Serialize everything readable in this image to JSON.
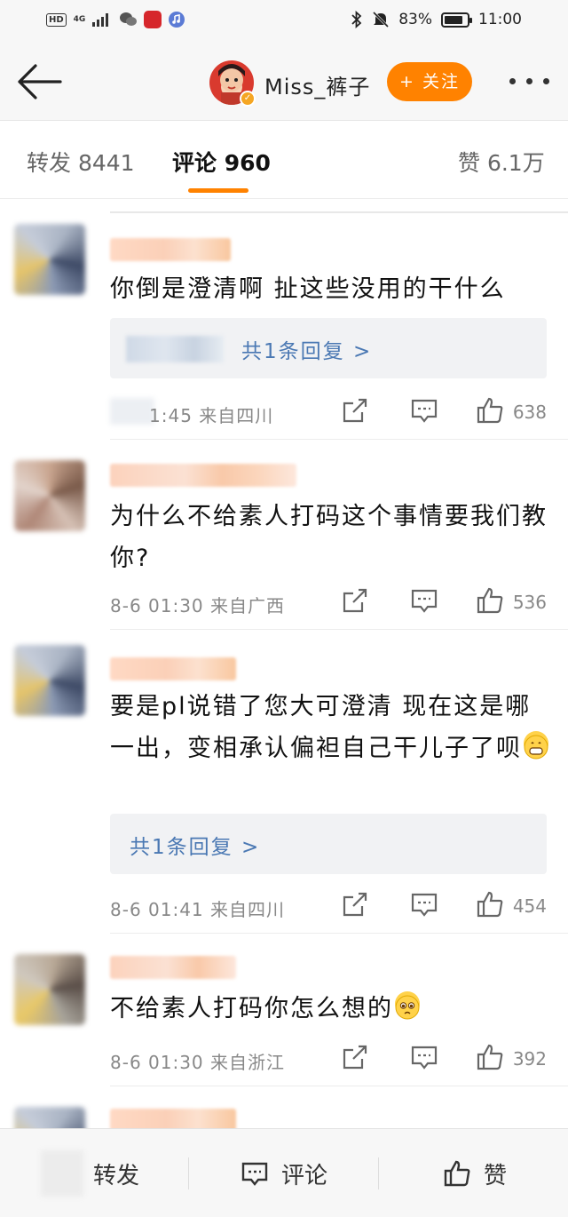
{
  "status_bar": {
    "hd": "HD",
    "network": "4G",
    "battery_text": "83%",
    "battery_level": 0.83,
    "time": "11:00"
  },
  "header": {
    "username": "Miss_裤子",
    "follow_label": "+ 关注"
  },
  "tabs": [
    {
      "label": "转发 8441"
    },
    {
      "label": "评论 960"
    },
    {
      "label": "赞 6.1万"
    }
  ],
  "comments": [
    {
      "text": "你倒是澄清啊 扯这些没用的干什么",
      "reply_link": "共1条回复 >",
      "time": "1:45 来自四川",
      "likes": "638"
    },
    {
      "text": "为什么不给素人打码这个事情要我们教你?",
      "time": "8-6 01:30 来自广西",
      "likes": "536"
    },
    {
      "text": "要是pl说错了您大可澄清  现在这是哪一出，变相承认偏袒自己干儿子了呗",
      "emoji": "grinning-emoji",
      "reply_link": "共1条回复 >",
      "time": "8-6 01:41 来自四川",
      "likes": "454"
    },
    {
      "text": "不给素人打码你怎么想的",
      "emoji": "pleading-emoji",
      "time": "8-6 01:30 来自浙江",
      "likes": "392"
    }
  ],
  "bottom_bar": {
    "repost_label": "转发",
    "comment_label": "评论",
    "like_label": "赞"
  },
  "colors": {
    "accent": "#ff8200",
    "link": "#4a78b3"
  }
}
